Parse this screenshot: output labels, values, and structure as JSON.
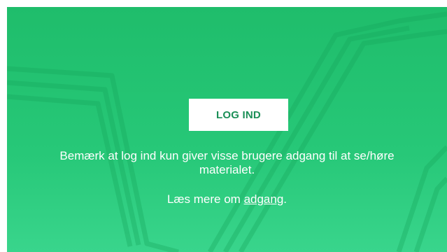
{
  "login": {
    "button_label": "LOG IND"
  },
  "notice": {
    "text": "Bemærk at log ind kun giver visse brugere adgang til at se/høre materialet."
  },
  "readmore": {
    "prefix": "Læs mere om ",
    "link_label": "adgang",
    "suffix": "."
  },
  "colors": {
    "background_top": "#1fbd6b",
    "background_bottom": "#39d58c",
    "button_text": "#1b8f57",
    "text": "#ffffff"
  }
}
